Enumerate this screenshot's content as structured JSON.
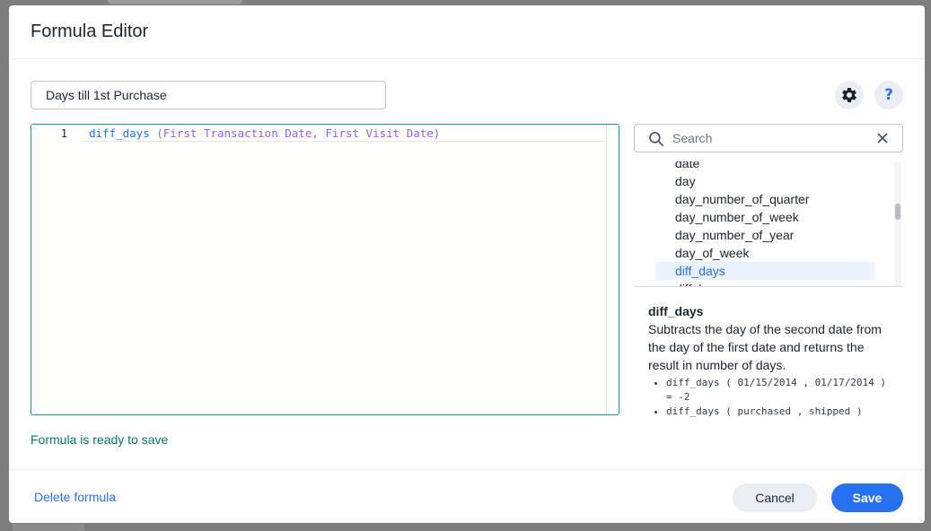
{
  "modal": {
    "title": "Formula Editor"
  },
  "formula_name": {
    "value": "Days till 1st Purchase"
  },
  "editor": {
    "line_number": "1",
    "function_name": "diff_days",
    "arguments": " (First Transaction Date, First Visit Date)"
  },
  "status": {
    "message": "Formula is ready to save",
    "color": "#067a5a"
  },
  "search": {
    "placeholder": "Search",
    "value": ""
  },
  "function_list": {
    "items": [
      {
        "label": "date",
        "selected": false
      },
      {
        "label": "day",
        "selected": false
      },
      {
        "label": "day_number_of_quarter",
        "selected": false
      },
      {
        "label": "day_number_of_week",
        "selected": false
      },
      {
        "label": "day_number_of_year",
        "selected": false
      },
      {
        "label": "day_of_week",
        "selected": false
      },
      {
        "label": "diff_days",
        "selected": true
      },
      {
        "label": "diff_hours",
        "selected": false
      }
    ]
  },
  "description": {
    "title": "diff_days",
    "text": "Subtracts the day of the second date from the day of the first date and returns the result in number of days.",
    "examples": [
      "diff_days ( 01/15/2014 , 01/17/2014 ) = -2",
      "diff_days ( purchased , shipped )"
    ]
  },
  "footer": {
    "delete_label": "Delete formula",
    "cancel_label": "Cancel",
    "save_label": "Save"
  },
  "icons": {
    "settings": "gear-icon",
    "help": "question-mark-icon",
    "search": "search-icon",
    "clear": "close-icon"
  },
  "colors": {
    "accent": "#2770ef",
    "editor_border": "#06a67c",
    "args": "#8c62f5"
  }
}
